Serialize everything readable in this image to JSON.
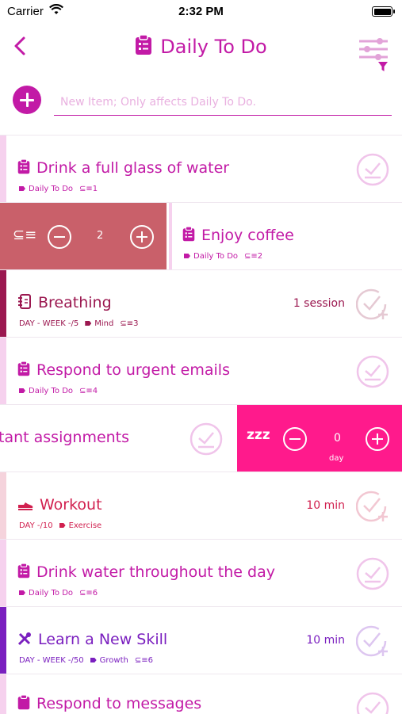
{
  "status_bar": {
    "carrier": "Carrier",
    "time": "2:32 PM"
  },
  "header": {
    "title": "Daily To Do"
  },
  "new_item": {
    "placeholder": "New Item; Only affects Daily To Do."
  },
  "colors": {
    "accent": "#c21aa6",
    "check_faded": "#f0c4ea",
    "swipe_red": "#c9606a",
    "swipe_pink": "#ff1a8c",
    "breathing": "#9b1850",
    "workout": "#d1204f",
    "learn": "#7a1fbf"
  },
  "items": [
    {
      "title": "Drink a full glass of water",
      "icon": "clipboard-icon",
      "tag": "Daily To Do",
      "order": "1",
      "right": ""
    },
    {
      "title": "Enjoy coffee",
      "icon": "clipboard-icon",
      "tag": "Daily To Do",
      "order": "2",
      "right": "",
      "swipe_value": "2"
    },
    {
      "title": "Breathing",
      "icon": "notebook-icon",
      "prefix": "DAY - WEEK -/5",
      "tag": "Mind",
      "order": "3",
      "right": "1 session"
    },
    {
      "title": "Respond to urgent emails",
      "icon": "clipboard-icon",
      "tag": "Daily To Do",
      "order": "4",
      "right": ""
    },
    {
      "title": "tant assignments",
      "icon": "",
      "snooze_value": "0",
      "snooze_unit": "day",
      "snooze_icon": "zzz"
    },
    {
      "title": "Workout",
      "icon": "shoe-icon",
      "prefix": "DAY -/10",
      "tag": "Exercise",
      "order": "",
      "right": "10 min"
    },
    {
      "title": "Drink water throughout the day",
      "icon": "clipboard-icon",
      "tag": "Daily To Do",
      "order": "6",
      "right": ""
    },
    {
      "title": "Learn a New Skill",
      "icon": "tools-icon",
      "prefix": "DAY - WEEK -/50",
      "tag": "Growth",
      "order": "6",
      "right": "10 min"
    },
    {
      "title": "Respond to messages",
      "icon": "clipboard-icon"
    }
  ]
}
